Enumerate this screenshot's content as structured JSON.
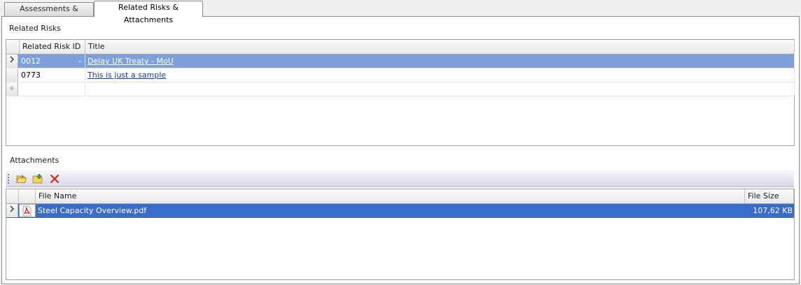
{
  "tabs": [
    {
      "label": "Assessments & Actions",
      "active": false
    },
    {
      "label": "Related Risks & Attachments",
      "active": true
    }
  ],
  "related_risks": {
    "label": "Related Risks",
    "columns": [
      "Related Risk ID",
      "Title"
    ],
    "rows": [
      {
        "id": "0012",
        "title": "Delay UK Treaty - MoU",
        "selected": true
      },
      {
        "id": "0773",
        "title": "This is just a sample",
        "selected": false
      }
    ],
    "new_row_marker": "✳"
  },
  "attachments": {
    "label": "Attachments",
    "toolbar": {
      "buttons": [
        {
          "name": "open-attachment-button",
          "icon": "folder-open-icon"
        },
        {
          "name": "add-attachment-button",
          "icon": "folder-add-icon"
        },
        {
          "name": "delete-attachment-button",
          "icon": "red-x-icon"
        }
      ]
    },
    "columns": [
      "File Name",
      "File Size"
    ],
    "rows": [
      {
        "file_name": "Steel Capacity Overview.pdf",
        "file_size": "107,62 KB",
        "icon": "pdf-icon",
        "selected": true
      }
    ]
  },
  "colors": {
    "selected_row_primary": "#7d9fdc",
    "selected_row_attachment": "#3a6cc9",
    "link": "#1a3c9e"
  }
}
